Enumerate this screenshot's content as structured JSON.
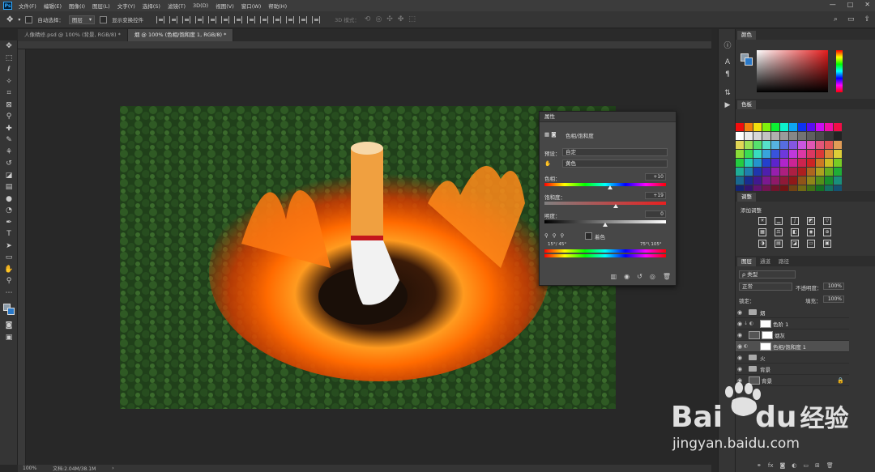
{
  "app": {
    "logo": "Ps",
    "menus": [
      "文件(F)",
      "编辑(E)",
      "图像(I)",
      "图层(L)",
      "文字(Y)",
      "选择(S)",
      "滤镜(T)",
      "3D(D)",
      "视图(V)",
      "窗口(W)",
      "帮助(H)"
    ],
    "win_min": "—",
    "win_max": "□",
    "win_close": "✕"
  },
  "options": {
    "auto_select": "自动选择：",
    "auto_select_value": "图层",
    "transform": "显示变换控件",
    "mode3d": "3D 模式："
  },
  "tabs": [
    {
      "label": "人像精修.psd @ 100% (背景, RGB/8) *"
    },
    {
      "label": "烟 @ 100% (色相/饱和度 1, RGB/8) *"
    }
  ],
  "status": {
    "zoom": "100%",
    "doc": "文档:2.04M/38.1M"
  },
  "properties": {
    "title": "属性",
    "panel_name": "色相/饱和度",
    "preset_label": "预设：",
    "preset_value": "自定",
    "channel_value": "黄色",
    "hue_label": "色相：",
    "hue_value": "+10",
    "sat_label": "饱和度：",
    "sat_value": "+19",
    "light_label": "明度：",
    "light_value": "0",
    "colorize": "着色",
    "range_left": "15°/ 45°",
    "range_right": "75°\\ 105°"
  },
  "panels": {
    "color_tab": "颜色",
    "swatch_tab": "色板",
    "adjust_tab": "调整",
    "adjust_hint": "添加调整",
    "layers_tab": "图层",
    "channels_tab": "通道",
    "paths_tab": "路径",
    "kind": "ρ 类型",
    "blend": "正常",
    "opacity_label": "不透明度：",
    "opacity": "100%",
    "lock_label": "锁定：",
    "fill_label": "填充：",
    "fill": "100%"
  },
  "layers": [
    {
      "name": "烟"
    },
    {
      "name": "色阶 1"
    },
    {
      "name": "烟灰"
    },
    {
      "name": "色相/饱和度 1"
    },
    {
      "name": "火"
    },
    {
      "name": "背景"
    },
    {
      "name": "背景"
    }
  ],
  "watermark": {
    "brand1": "Bai",
    "brand2": "du",
    "brand3": "经验",
    "url": "jingyan.baidu.com"
  },
  "colors": {
    "accent": "#31a8ff",
    "bg_swatch": "#2a79c8"
  }
}
